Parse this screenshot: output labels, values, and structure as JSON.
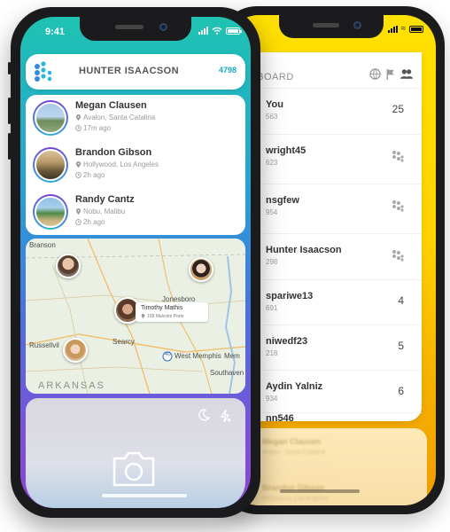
{
  "back_phone": {
    "leaderboard_title": "-BOARD",
    "rows": [
      {
        "name": "You",
        "sub": "563",
        "score": "25"
      },
      {
        "name": "wright45",
        "sub": "623",
        "score": ""
      },
      {
        "name": "nsgfew",
        "sub": "954",
        "score": ""
      },
      {
        "name": "Hunter Isaacson",
        "sub": "298",
        "score": ""
      },
      {
        "name": "spariwe13",
        "sub": "691",
        "score": "4"
      },
      {
        "name": "niwedf23",
        "sub": "218",
        "score": "5"
      },
      {
        "name": "Aydin Yalniz",
        "sub": "934",
        "score": "6"
      },
      {
        "name": "nn546",
        "sub": "",
        "score": ""
      }
    ],
    "blurred": [
      {
        "name": "Megan Clausen",
        "sub": "Avalon, Santa Catalina"
      },
      {
        "name": "Brandon Gibson",
        "sub": "Hollywood, Los Angeles"
      }
    ]
  },
  "front_phone": {
    "status": {
      "time": "9:41"
    },
    "header": {
      "username": "HUNTER ISAACSON",
      "score": "4798"
    },
    "friends": [
      {
        "name": "Megan Clausen",
        "location": "Avalon, Santa Catalina",
        "time": "17m ago"
      },
      {
        "name": "Brandon Gibson",
        "location": "Hollywood, Los Angeles",
        "time": "2h ago"
      },
      {
        "name": "Randy Cantz",
        "location": "Nobu, Malibu",
        "time": "2h ago"
      }
    ],
    "map": {
      "labels": {
        "branson": "Branson",
        "jonesboro": "Jonesboro",
        "searcy": "Searcy",
        "russellville": "Russellvil",
        "west_memphis": "West Memphis",
        "memphis": "Mem",
        "southaven": "Southaven",
        "state": "ARKANSAS",
        "highway": "40"
      },
      "callout": {
        "name": "Timothy Mathis",
        "address": "109 Malcolm Ports"
      }
    }
  }
}
